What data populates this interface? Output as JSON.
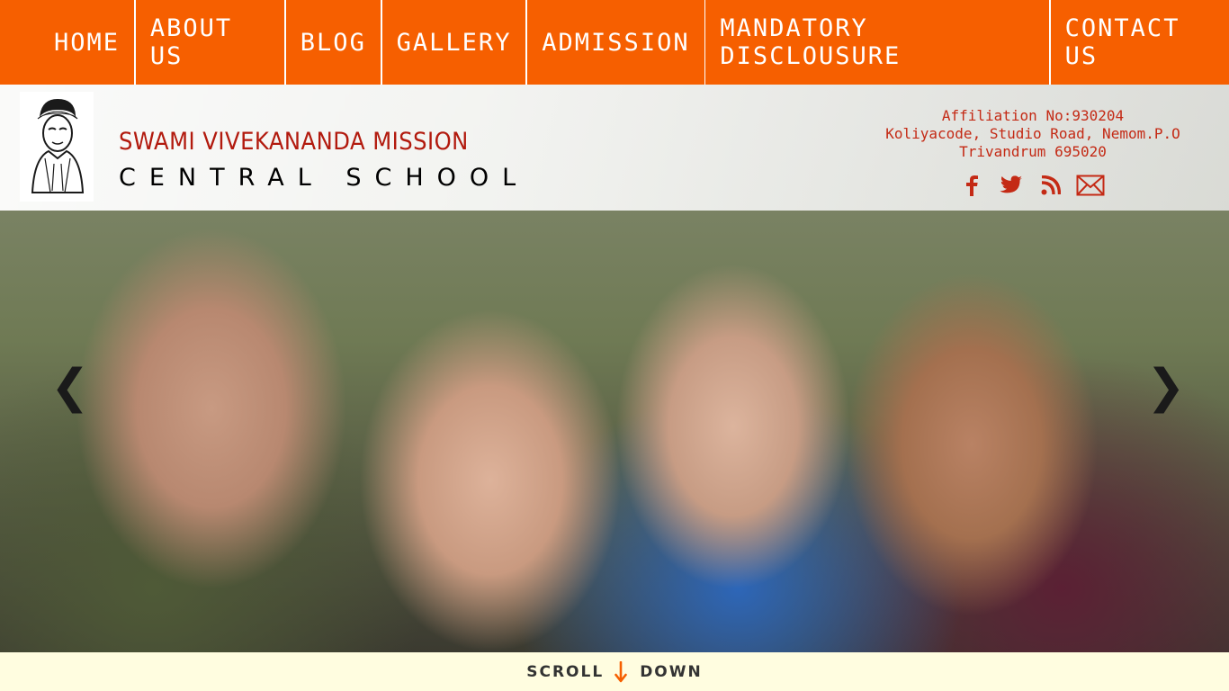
{
  "nav": {
    "items": [
      {
        "label": "HOME"
      },
      {
        "label": "ABOUT US"
      },
      {
        "label": "BLOG"
      },
      {
        "label": "GALLERY"
      },
      {
        "label": "ADMISSION"
      },
      {
        "label": "MANDATORY DISCLOUSURE"
      },
      {
        "label": "CONTACT US"
      }
    ]
  },
  "header": {
    "school_line1": "SWAMI VIVEKANANDA MISSION",
    "school_line2": "CENTRAL SCHOOL",
    "address_line1": "Affiliation No:930204",
    "address_line2": "Koliyacode, Studio Road, Nemom.P.O",
    "address_line3": "Trivandrum 695020",
    "social_icons": [
      "facebook-icon",
      "twitter-icon",
      "rss-icon",
      "mail-icon"
    ]
  },
  "slider": {
    "prev_glyph": "❮",
    "next_glyph": "❯"
  },
  "scroll": {
    "left_word": "SCROLL",
    "right_word": "DOWN"
  },
  "colors": {
    "nav_bg": "#f65f00",
    "brand_red": "#b21a0e",
    "address_red": "#c42a15",
    "scroll_bg": "#fffde0"
  }
}
